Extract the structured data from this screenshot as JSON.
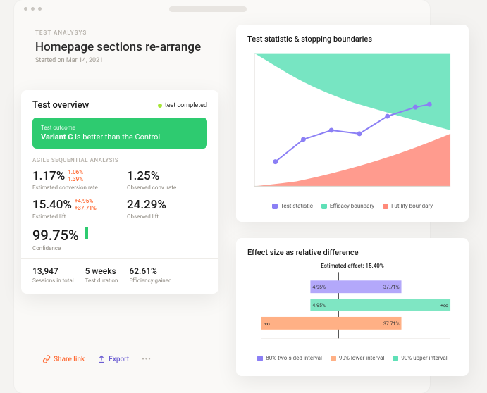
{
  "header": {
    "overline": "TEST ANALYSYS",
    "title": "Homepage sections re-arrange",
    "subtitle": "Started on Mar 14, 2021"
  },
  "overview": {
    "title": "Test overview",
    "status": "test completed",
    "outcome_label": "Test outcome",
    "outcome_bold": "Variant C",
    "outcome_rest": " is better than the Control",
    "section_label": "AGILE SEQUENTIAL ANALYSIS",
    "est_conv": {
      "value": "1.17%",
      "low": "1.06%",
      "high": "1.39%",
      "label": "Estimated conversion rate"
    },
    "obs_conv": {
      "value": "1.25%",
      "label": "Observed conv. rate"
    },
    "est_lift": {
      "value": "15.40%",
      "low": "+4.95%",
      "high": "+37.71%",
      "label": "Estimated lift"
    },
    "obs_lift": {
      "value": "24.29%",
      "label": "Observed lift"
    },
    "confidence": {
      "value": "99.75%",
      "label": "Confidence"
    },
    "sessions": {
      "value": "13,947",
      "label": "Sessions in total"
    },
    "duration": {
      "value": "5 weeks",
      "label": "Test duration"
    },
    "efficiency": {
      "value": "62.61%",
      "label": "Efficiency gained"
    }
  },
  "actions": {
    "share": "Share link",
    "export": "Export",
    "more": "•••"
  },
  "stat_chart": {
    "title": "Test statistic & stopping boundaries",
    "legend": {
      "stat": "Test statistic",
      "efficacy": "Efficacy boundary",
      "futility": "Futility boundary"
    }
  },
  "effect_chart": {
    "title": "Effect size as relative difference",
    "estimated_label": "Estimated effect: 15.40%",
    "legend": {
      "twosided": "80% two-sided interval",
      "lower": "90% lower interval",
      "upper": "90% upper interval"
    },
    "bar_labels": {
      "l1": "4.95%",
      "r1": "37.71%",
      "l2": "4.95%",
      "r2": "+∞",
      "l3": "-∞",
      "r3": "37.71%"
    }
  },
  "colors": {
    "green": "#2ecb70",
    "purple": "#8b7ff5",
    "teal": "#5fe0b7",
    "red": "#ff8a7a",
    "orange": "#ff6b35",
    "violet": "#6b5dd3"
  },
  "chart_data": [
    {
      "type": "line",
      "title": "Test statistic & stopping boundaries",
      "x": [
        1,
        2,
        3,
        4,
        5,
        6,
        7
      ],
      "series": [
        {
          "name": "Test statistic",
          "values": [
            0.8,
            1.6,
            1.9,
            1.8,
            2.3,
            2.6,
            2.7
          ]
        }
      ],
      "boundaries": {
        "efficacy": [
          4.2,
          3.6,
          3.2,
          2.9,
          2.7,
          2.5,
          2.3
        ],
        "futility": [
          -2.0,
          -1.4,
          -0.8,
          -0.1,
          0.6,
          1.3,
          2.3
        ]
      },
      "ylim": [
        -2,
        4.5
      ],
      "xlabel": "",
      "ylabel": ""
    },
    {
      "type": "bar",
      "title": "Effect size as relative difference",
      "estimate": 15.4,
      "series": [
        {
          "name": "80% two-sided interval",
          "low": 4.95,
          "high": 37.71
        },
        {
          "name": "90% lower interval",
          "low": 4.95,
          "high": null
        },
        {
          "name": "90% upper interval",
          "low": null,
          "high": 37.71
        }
      ],
      "xlim": [
        -10,
        50
      ],
      "xlabel": "",
      "ylabel": ""
    }
  ]
}
